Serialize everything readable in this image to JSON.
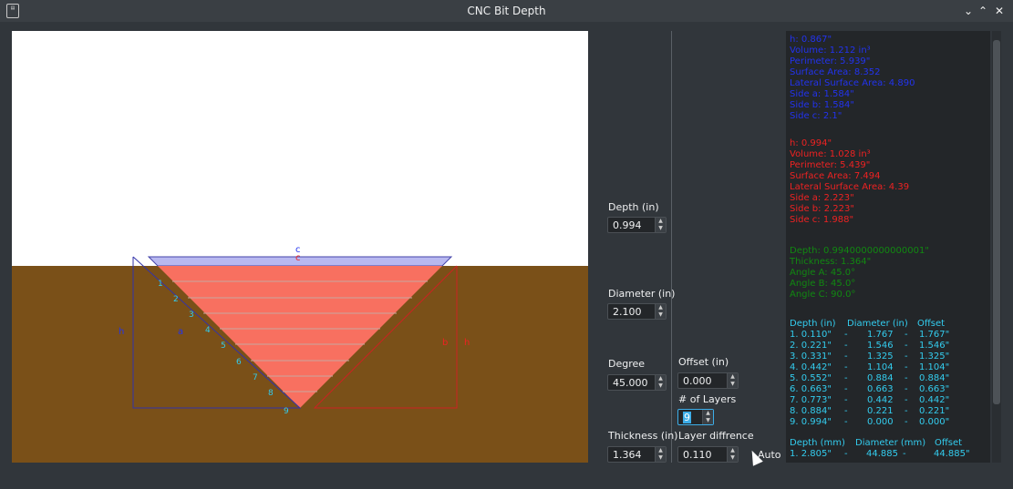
{
  "window": {
    "title": "CNC Bit Depth",
    "icon_name": "app-icon",
    "min_icon": "chevron-down-icon",
    "max_icon": "chevron-up-icon",
    "close_icon": "close-icon"
  },
  "diagram": {
    "label_c": "c",
    "label_h": "h",
    "label_a": "a",
    "label_b": "b",
    "layer_numbers": [
      "1",
      "2",
      "3",
      "4",
      "5",
      "6",
      "7",
      "8",
      "9"
    ],
    "colors": {
      "ground": "#7a5018",
      "cut": "#f87060",
      "top_band": "#b8b8f0"
    }
  },
  "inputs": {
    "depth_label": "Depth (in)",
    "depth_value": "0.994",
    "diameter_label": "Diameter (in)",
    "diameter_value": "2.100",
    "degree_label": "Degree",
    "degree_value": "45.000",
    "thickness_label": "Thickness (in)",
    "thickness_value": "1.364",
    "offset_label": "Offset (in)",
    "offset_value": "0.000",
    "layers_label": "# of Layers",
    "layers_value": "9",
    "layer_diff_label": "Layer diffrence",
    "layer_diff_value": "0.110",
    "auto_label": "Auto"
  },
  "output": {
    "blue": [
      "h: 0.867\"",
      "Volume: 1.212 in³",
      "Perimeter: 5.939\"",
      "Surface Area: 8.352",
      "Lateral Surface Area: 4.890",
      "Side a: 1.584\"",
      "Side b: 1.584\"",
      "Side c: 2.1\""
    ],
    "red": [
      "h: 0.994\"",
      "Volume: 1.028 in³",
      "Perimeter: 5.439\"",
      "Surface Area: 7.494",
      "Lateral Surface Area: 4.39",
      "Side a: 2.223\"",
      "Side b: 2.223\"",
      "Side c: 1.988\""
    ],
    "green": [
      "Depth: 0.9940000000000001\"",
      "Thickness: 1.364\"",
      "Angle A: 45.0°",
      "Angle B: 45.0°",
      "Angle C: 90.0°"
    ],
    "table_in": {
      "headers": [
        "Depth (in)",
        "Diameter (in)",
        "Offset"
      ],
      "rows": [
        [
          "1. 0.110\"",
          "-",
          "1.767",
          "-",
          "1.767\""
        ],
        [
          "2. 0.221\"",
          "-",
          "1.546",
          "-",
          "1.546\""
        ],
        [
          "3. 0.331\"",
          "-",
          "1.325",
          "-",
          "1.325\""
        ],
        [
          "4. 0.442\"",
          "-",
          "1.104",
          "-",
          "1.104\""
        ],
        [
          "5. 0.552\"",
          "-",
          "0.884",
          "-",
          "0.884\""
        ],
        [
          "6. 0.663\"",
          "-",
          "0.663",
          "-",
          "0.663\""
        ],
        [
          "7. 0.773\"",
          "-",
          "0.442",
          "-",
          "0.442\""
        ],
        [
          "8. 0.884\"",
          "-",
          "0.221",
          "-",
          "0.221\""
        ],
        [
          "9. 0.994\"",
          "-",
          "0.000",
          "-",
          "0.000\""
        ]
      ]
    },
    "table_mm": {
      "headers": [
        "Depth (mm)",
        "Diameter (mm)",
        "Offset"
      ],
      "rows": [
        [
          "1. 2.805\"",
          "-",
          "44.885",
          "-",
          "44.885\""
        ]
      ]
    },
    "colors": {
      "blue": "#2233ee",
      "red": "#ee2222",
      "green": "#118811",
      "cyan": "#33ccee"
    }
  }
}
